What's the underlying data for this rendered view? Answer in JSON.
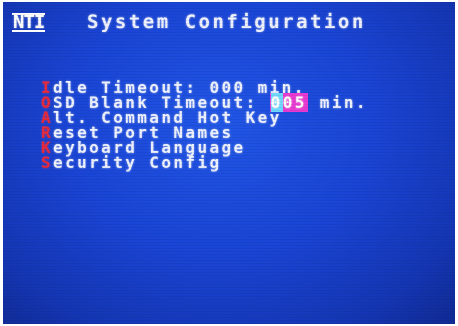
{
  "header": {
    "logo": "NTI",
    "title": "System Configuration"
  },
  "menu": {
    "items": [
      {
        "hotkey": "I",
        "label": "dle Timeout: 000 min."
      },
      {
        "hotkey": "O",
        "label_before": "SD Blank Timeout: ",
        "value_cursor": "0",
        "value_rest": "05",
        "label_after": " min."
      },
      {
        "hotkey": "A",
        "label": "lt. Command Hot Key"
      },
      {
        "hotkey": "R",
        "label": "eset Port Names"
      },
      {
        "hotkey": "K",
        "label": "eyboard Language"
      },
      {
        "hotkey": "S",
        "label": "ecurity Config"
      }
    ]
  },
  "colors": {
    "background": "#1a45d6",
    "text": "#eef2ff",
    "hotkey": "#e82a3c",
    "highlight": "#e83ad2",
    "cursor": "#6fd8ff"
  }
}
